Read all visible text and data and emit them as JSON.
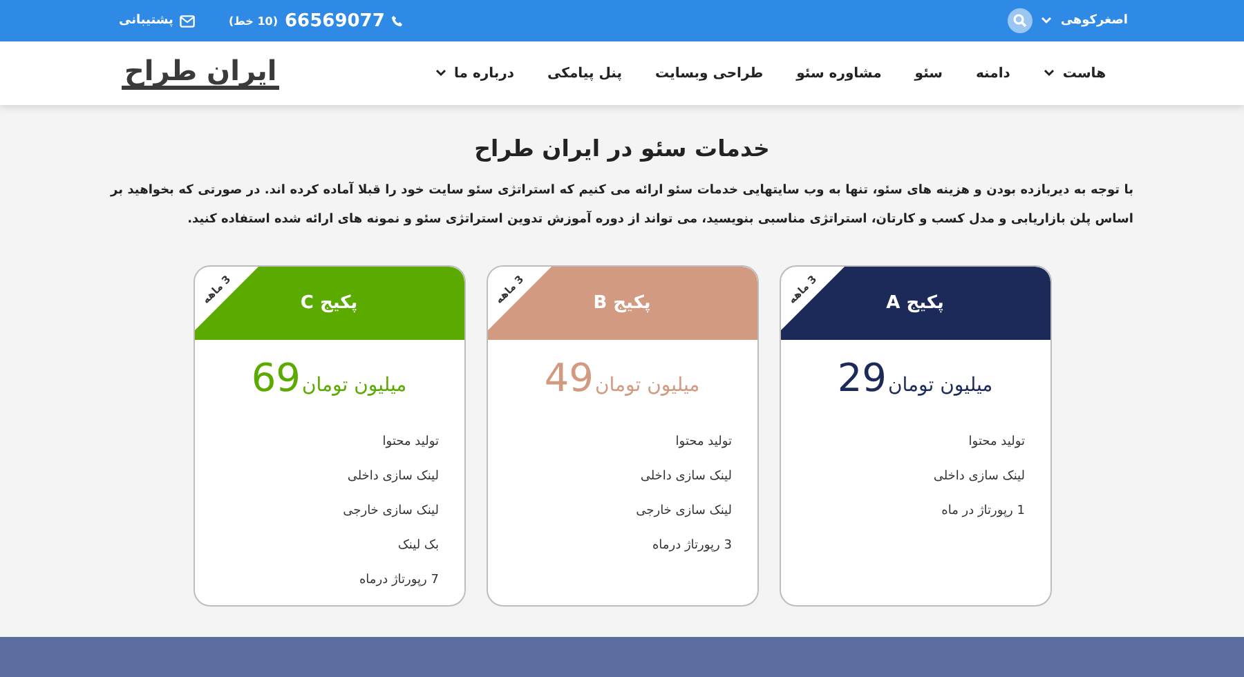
{
  "top_bar": {
    "user": "اصغرکوهی",
    "phone": "66569077",
    "phone_lines": "(10 خط)",
    "support": "پشتیبانی"
  },
  "nav": {
    "logo": "ایران طراح",
    "items": [
      {
        "label": "هاست",
        "dropdown": true
      },
      {
        "label": "دامنه",
        "dropdown": false
      },
      {
        "label": "سئو",
        "dropdown": false
      },
      {
        "label": "مشاوره سئو",
        "dropdown": false
      },
      {
        "label": "طراحی وبسایت",
        "dropdown": false
      },
      {
        "label": "پنل پیامکی",
        "dropdown": false
      },
      {
        "label": "درباره ما",
        "dropdown": true
      }
    ]
  },
  "heading": "خدمات سئو در ایران طراح",
  "intro": "با توجه به دیربازده بودن و هزینه های سئو، تنها به وب سایتهایی خدمات سئو ارائه می کنیم که استراتژی سئو سایت خود را قبلا آماده کرده اند. در صورتی که بخواهید بر اساس پلن بازاریابی و مدل کسب و کارتان، استراتژی مناسبی بنویسید، می تواند از دوره آموزش تدوین استراتژی سئو و نمونه های ارائه شده استفاده کنید.",
  "packages": [
    {
      "title": "پکیج A",
      "ribbon": "3 ماهه",
      "price": "29",
      "unit": "میلیون تومان",
      "color": "#1c2a5a",
      "features": [
        "تولید محتوا",
        "لینک سازی داخلی",
        "1 رپورتاژ در ماه"
      ]
    },
    {
      "title": "پکیج B",
      "ribbon": "3 ماهه",
      "price": "49",
      "unit": "میلیون تومان",
      "color": "#d29a80",
      "features": [
        "تولید محتوا",
        "لینک سازی داخلی",
        "لینک سازی خارجی",
        "3 رپورتاژ درماه"
      ]
    },
    {
      "title": "پکیج C",
      "ribbon": "3 ماهه",
      "price": "69",
      "unit": "میلیون تومان",
      "color": "#5aaa00",
      "features": [
        "تولید محتوا",
        "لینک سازی داخلی",
        "لینک سازی خارجی",
        "بک لینک",
        "7 رپورتاژ درماه"
      ]
    }
  ]
}
